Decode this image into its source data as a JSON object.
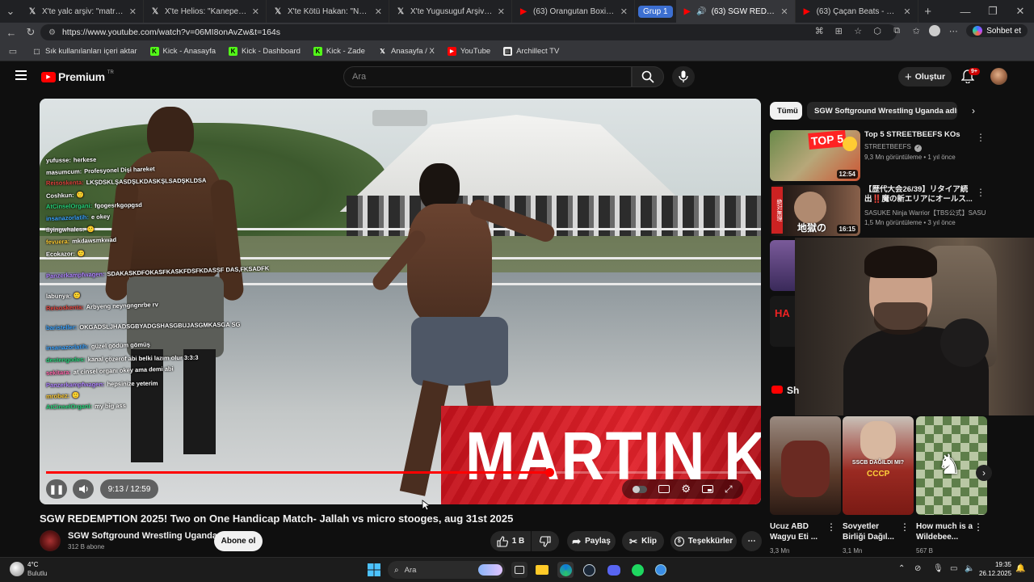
{
  "browser": {
    "tabs": [
      {
        "icon": "x-icon",
        "title": "X'te yalc arşiv: \"matrix - neden b"
      },
      {
        "icon": "x-icon",
        "title": "X'te Helios: \"Kanepede sızıp kalı"
      },
      {
        "icon": "x-icon",
        "title": "X'te Kötü Hakan: \"Nobel verilme"
      },
      {
        "icon": "x-icon",
        "title": "X'te Yugusuguf Arşiv: \"donald tr"
      },
      {
        "icon": "youtube-icon",
        "title": "(63) Orangutan Boxing - YouTub"
      },
      {
        "icon": "youtube-icon",
        "title": "(63) SGW REDEMPTION 202"
      },
      {
        "icon": "youtube-icon",
        "title": "(63) Çaçan Beats - Lucifer [ Offic"
      }
    ],
    "group_label": "Grup 1",
    "url": "https://www.youtube.com/watch?v=06MI8onAvZw&t=164s",
    "chat_button": "Sohbet et",
    "bookmarks": [
      {
        "icon": "import-icon",
        "label": "Sık kullanılanları içeri aktar"
      },
      {
        "icon": "kick-icon",
        "label": "Kick - Anasayfa"
      },
      {
        "icon": "kick-icon",
        "label": "Kick - Dashboard"
      },
      {
        "icon": "kick-icon",
        "label": "Kick - Zade"
      },
      {
        "icon": "x-icon",
        "label": "Anasayfa / X"
      },
      {
        "icon": "youtube-icon",
        "label": "YouTube"
      },
      {
        "icon": "archillect-icon",
        "label": "Archillect TV"
      }
    ]
  },
  "youtube": {
    "logo": "Premium",
    "logo_region": "TR",
    "search_placeholder": "Ara",
    "create_label": "Oluştur",
    "notif_count": "9+"
  },
  "video": {
    "overlay_name": "MARTIN K",
    "time": "9:13 / 12:59",
    "progress": 0.71,
    "title": "SGW REDEMPTION 2025! Two on One Handicap Match- Jallah vs micro stooges, aug 31st 2025",
    "channel": "SGW Softground Wrestling Uganda",
    "subscribers": "312 B abone",
    "subscribe_label": "Abone ol",
    "likes": "1 B",
    "share_label": "Paylaş",
    "clip_label": "Klip",
    "thanks_label": "Teşekkürler"
  },
  "chat": [
    {
      "name": "yufusse:",
      "color": "#ffffff",
      "msg": "herkese"
    },
    {
      "name": "masumcum:",
      "color": "#ffffff",
      "msg": "Profesyonel Dişi hareket"
    },
    {
      "name": "Reisoskenta:",
      "color": "#e0443e",
      "msg": "LKŞDSKLŞASDŞLKDASKŞLSADŞKLDSA"
    },
    {
      "name": "Coshkun:",
      "color": "#ffffff",
      "msg": "🙂"
    },
    {
      "name": "AtCinselOrgani:",
      "color": "#27d47a",
      "msg": "fgogesrkgopgsd"
    },
    {
      "name": "insanazorlatih:",
      "color": "#3aa3ff",
      "msg": "e okey"
    },
    {
      "name": "flyingwhales:",
      "color": "#ffffff",
      "msg": "🙂"
    },
    {
      "name": "fevuera:",
      "color": "#ffcc33",
      "msg": "mkdawsmkwad"
    },
    {
      "name": "Ecokazor:",
      "color": "#ffffff",
      "msg": "🙂"
    },
    {
      "name": "Panzerkampfwagen:",
      "color": "#b084ff",
      "msg": "SDAKASKDFOKASFKASKFDSFKDASSF DAS,FKSADFK"
    },
    {
      "name": "labunya:",
      "color": "#ffffff",
      "msg": "🙂"
    },
    {
      "name": "Reisoskenta:",
      "color": "#e0443e",
      "msg": "Arbyeng neyngngnrbe rv"
    },
    {
      "name": "baristeller:",
      "color": "#3aa3ff",
      "msg": "OKGADSLJHADSGBYADGSHASGBUJASGMKASGA SG"
    },
    {
      "name": "insanazorlatih:",
      "color": "#3aa3ff",
      "msg": "güzel gödüm gömüş"
    },
    {
      "name": "destengodes:",
      "color": "#27d47a",
      "msg": "kanal çözerof abi belki lazım olur 3:3:3"
    },
    {
      "name": "sekitara:",
      "color": "#ff66aa",
      "msg": "at cinsel organı okey ama demi abi"
    },
    {
      "name": "Panzerkampfwagen:",
      "color": "#b084ff",
      "msg": "hepsinize yeterim"
    },
    {
      "name": "mrobez:",
      "color": "#ffcc33",
      "msg": "🙂"
    },
    {
      "name": "AtCinselOrgani:",
      "color": "#27d47a",
      "msg": "my big ass"
    }
  ],
  "sidebar": {
    "chips": [
      "Tümü",
      "SGW Softground Wrestling Uganda adlı yük"
    ],
    "recommendations": [
      {
        "title": "Top 5 STREETBEEFS KOs",
        "channel": "STREETBEEFS",
        "verified": true,
        "meta": "9,3 Mn görüntüleme • 1 yıl önce",
        "duration": "12:54"
      },
      {
        "title": "【歴代大会26/39】リタイア続出‼️魔の新エリアにオールス...",
        "channel": "SASUKE Ninja Warrior【TBS公式】SASU...",
        "verified": false,
        "meta": "1,5 Mn görüntüleme • 3 yıl önce",
        "duration": "16:15"
      }
    ],
    "shorts_header": "Sh",
    "shorts": [
      {
        "title": "Ucuz ABD Wagyu Eti ...",
        "views": "3,3 Mn"
      },
      {
        "title": "Sovyetler Birliği Dağıl...",
        "views": "3,1 Mn"
      },
      {
        "title": "How much is a Wildebee...",
        "views": "567 B"
      }
    ],
    "short_caption": "SSCB DAĞILDI MI?"
  },
  "taskbar": {
    "temp": "4°C",
    "weather": "Bulutlu",
    "search_placeholder": "Ara",
    "time": "19:35",
    "date": "26.12.2025"
  },
  "colors": {
    "accent": "#ff0000",
    "bg": "#0f0f0f",
    "chip_active": "#f1f1f1"
  }
}
